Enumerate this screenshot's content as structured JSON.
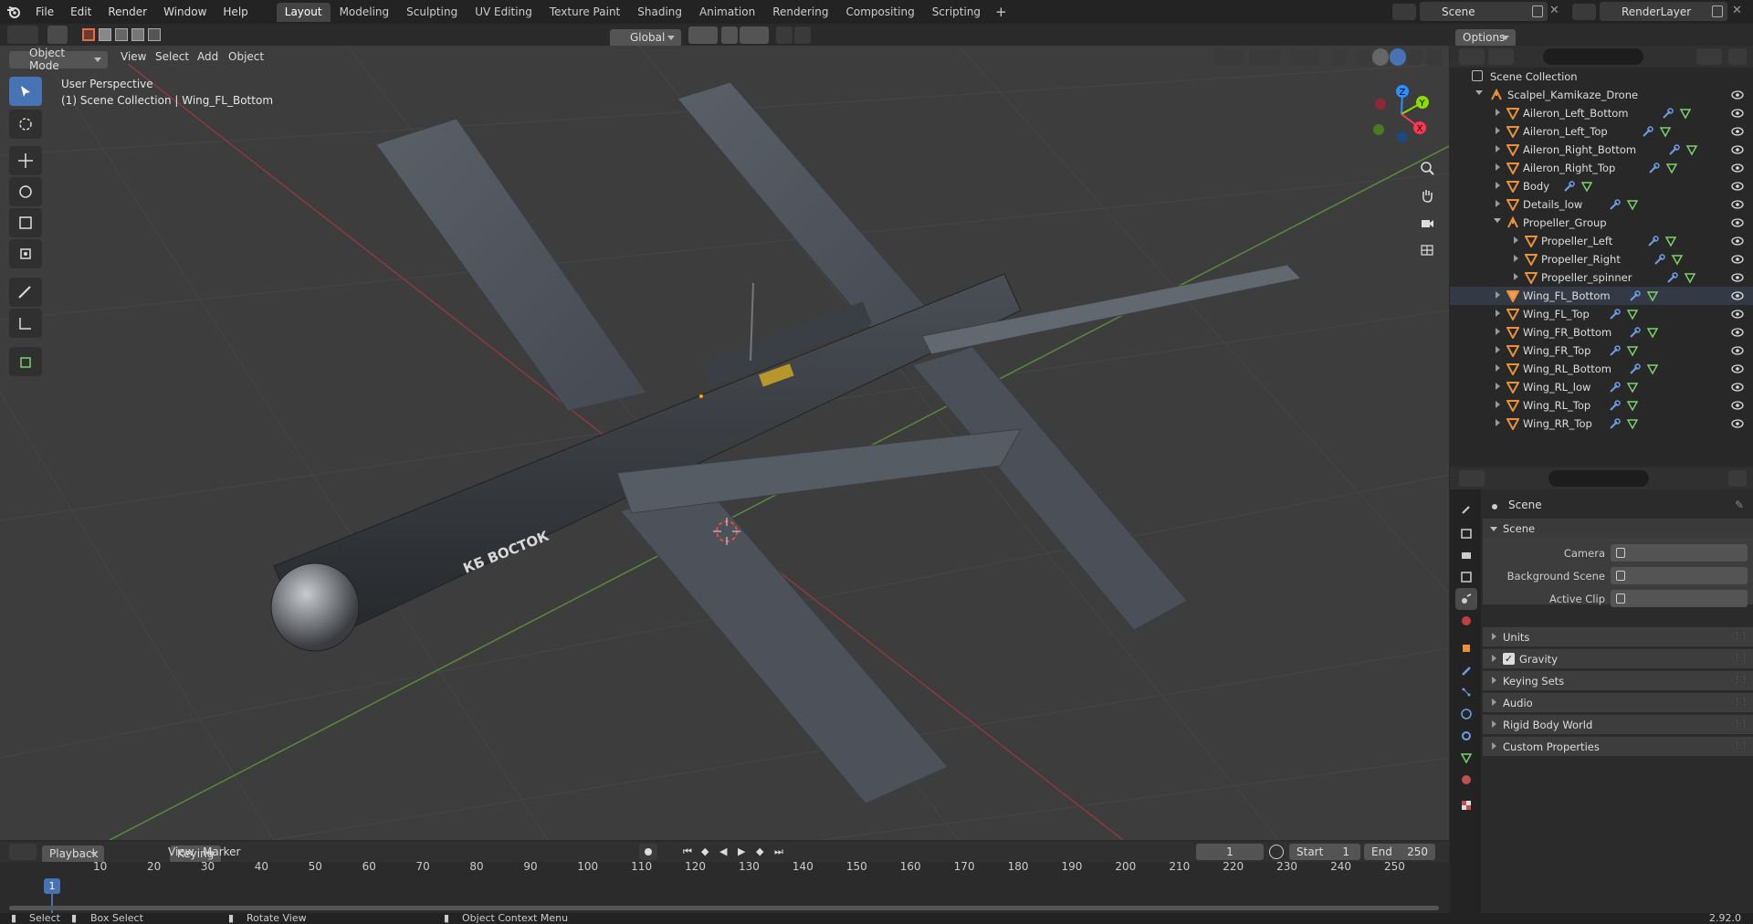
{
  "topbar": {
    "menus": [
      "File",
      "Edit",
      "Render",
      "Window",
      "Help"
    ],
    "workspaces": [
      "Layout",
      "Modeling",
      "Sculpting",
      "UV Editing",
      "Texture Paint",
      "Shading",
      "Animation",
      "Rendering",
      "Compositing",
      "Scripting"
    ],
    "active_workspace": "Layout",
    "scene_name": "Scene",
    "view_layer": "RenderLayer"
  },
  "viewport_header": {
    "mode": "Object Mode",
    "menus": [
      "View",
      "Select",
      "Add",
      "Object"
    ],
    "transform_orientation": "Global",
    "options_label": "Options"
  },
  "viewport": {
    "perspective_label": "User Perspective",
    "context_label": "(1) Scene Collection | Wing_FL_Bottom",
    "fuselage_text": "КБ ВОСТОК",
    "gizmo_axes": [
      "Z",
      "Y",
      "X"
    ]
  },
  "outliner": {
    "root": "Scene Collection",
    "collection": "Scalpel_Kamikaze_Drone",
    "items": [
      {
        "name": "Aileron_Left_Bottom",
        "level": 1
      },
      {
        "name": "Aileron_Left_Top",
        "level": 1
      },
      {
        "name": "Aileron_Right_Bottom",
        "level": 1
      },
      {
        "name": "Aileron_Right_Top",
        "level": 1
      },
      {
        "name": "Body",
        "level": 1
      },
      {
        "name": "Details_low",
        "level": 1
      },
      {
        "name": "Propeller_Group",
        "level": 1,
        "is_group": true
      },
      {
        "name": "Propeller_Left",
        "level": 2
      },
      {
        "name": "Propeller_Right",
        "level": 2
      },
      {
        "name": "Propeller_spinner",
        "level": 2
      },
      {
        "name": "Wing_FL_Bottom",
        "level": 1,
        "selected": true
      },
      {
        "name": "Wing_FL_Top",
        "level": 1
      },
      {
        "name": "Wing_FR_Bottom",
        "level": 1
      },
      {
        "name": "Wing_FR_Top",
        "level": 1
      },
      {
        "name": "Wing_RL_Bottom",
        "level": 1
      },
      {
        "name": "Wing_RL_low",
        "level": 1
      },
      {
        "name": "Wing_RL_Top",
        "level": 1
      },
      {
        "name": "Wing_RR_Top",
        "level": 1
      }
    ]
  },
  "properties": {
    "context_title": "Scene",
    "panel_title": "Scene",
    "fields": [
      {
        "label": "Camera"
      },
      {
        "label": "Background Scene"
      },
      {
        "label": "Active Clip"
      }
    ],
    "subpanels": [
      "Units",
      "Gravity",
      "Keying Sets",
      "Audio",
      "Rigid Body World",
      "Custom Properties"
    ],
    "gravity_checked": true
  },
  "timeline": {
    "menus": [
      "Playback",
      "Keying",
      "View",
      "Marker"
    ],
    "current_frame": "1",
    "start_label": "Start",
    "start_value": "1",
    "end_label": "End",
    "end_value": "250",
    "ticks": [
      "1",
      "10",
      "20",
      "30",
      "40",
      "50",
      "60",
      "70",
      "80",
      "90",
      "100",
      "110",
      "120",
      "130",
      "140",
      "150",
      "160",
      "170",
      "180",
      "190",
      "200",
      "210",
      "220",
      "230",
      "240",
      "250"
    ]
  },
  "statusbar": {
    "select": "Select",
    "box_select": "Box Select",
    "rotate_view": "Rotate View",
    "context_menu": "Object Context Menu",
    "version": "2.92.0"
  },
  "colors": {
    "accent": "#4772b3",
    "object_orange": "#e8913b",
    "modifier_blue": "#6d9ee8",
    "mesh_green": "#7ad36a",
    "axis_x": "#ff3352",
    "axis_y": "#8bdc00",
    "axis_z": "#2890ff"
  }
}
